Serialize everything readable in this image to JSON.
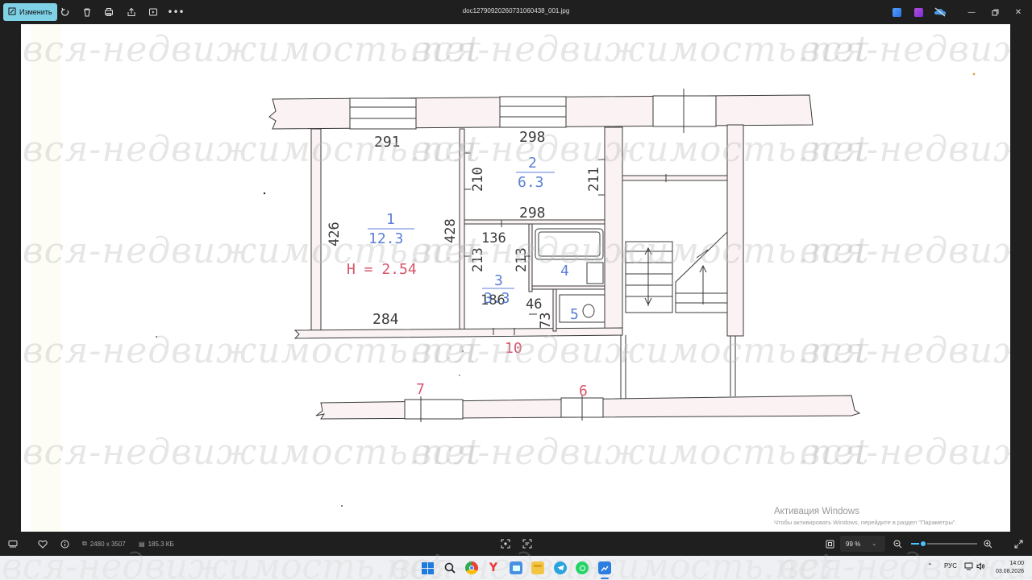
{
  "toolbar": {
    "edit_label": "Изменить",
    "file_name": "doc12790920260731060438_001.jpg"
  },
  "plan": {
    "watermark": "вся-недвижимость.net",
    "rooms": [
      {
        "number": "1",
        "area": "12.3"
      },
      {
        "number": "2",
        "area": "6.3"
      },
      {
        "number": "3",
        "area": "3.3"
      },
      {
        "number": "4",
        "area": ""
      },
      {
        "number": "5",
        "area": ""
      }
    ],
    "height_label": "H = 2.54",
    "dims": {
      "d291": "291",
      "d298a": "298",
      "d210": "210",
      "d211": "211",
      "d298b": "298",
      "d426": "426",
      "d428": "428",
      "d136": "136",
      "d213a": "213",
      "d213b": "213",
      "d46": "46",
      "d73": "73",
      "d284": "284",
      "d186": "186"
    },
    "labels": {
      "l10": "10",
      "l7": "7",
      "l6": "6"
    }
  },
  "status": {
    "dimensions": "2480 x 3507",
    "file_size": "185.3 КБ",
    "zoom": "99 %",
    "zoom_fraction": 0.18
  },
  "activation": {
    "title": "Активация Windows",
    "subtitle": "Чтобы активировать Windows, перейдите в раздел \"Параметры\"."
  },
  "taskbar": {
    "lang": "РУС",
    "time": "14:00",
    "date": "03.08.2026"
  },
  "colors": {
    "accent": "#7fd1e6",
    "plan_red": "#d9546a",
    "plan_blue": "#5b7fd6",
    "wall_fill": "#fbf3f3"
  }
}
